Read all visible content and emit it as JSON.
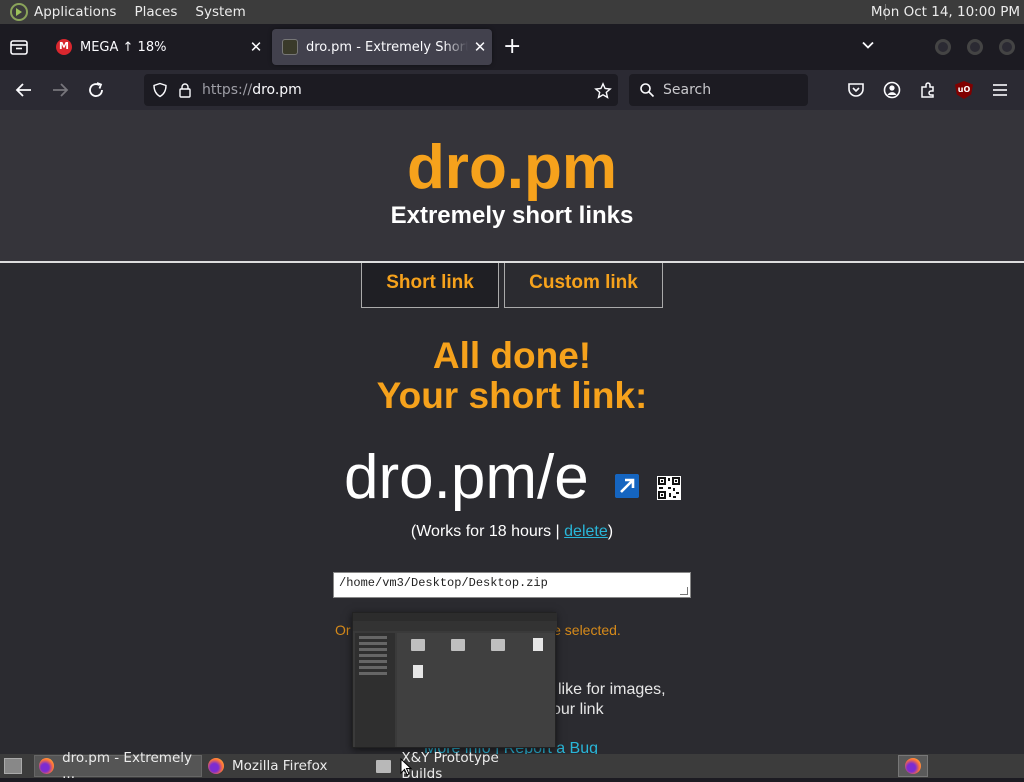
{
  "top_panel": {
    "menus": [
      "Applications",
      "Places",
      "System"
    ],
    "clock": "Mon Oct 14, 10:00 PM"
  },
  "browser": {
    "tabs": [
      {
        "title": "MEGA ↑ 18%",
        "favicon": "mega-icon",
        "active": false
      },
      {
        "title": "dro.pm - Extremely Short Li",
        "favicon": "dro-icon",
        "active": true
      }
    ],
    "url_scheme": "https://",
    "url_host": "dro.pm",
    "search_placeholder": "Search"
  },
  "page": {
    "site_name": "dro.pm",
    "tagline": "Extremely short links",
    "tabs": [
      "Short link",
      "Custom link"
    ],
    "done_line1": "All done!",
    "done_line2": "Your short link:",
    "short_link": "dro.pm/e",
    "works_prefix": "(Works for 18 hours | ",
    "delete_label": "delete",
    "works_suffix": ")",
    "path_value": "/home/vm3/Desktop/Desktop.zip",
    "orange_left": "Or",
    "orange_right": "le selected.",
    "info_line1": "like for images,",
    "info_line2": "our link",
    "bottom_links": "More info | Report a Bug",
    "accent_color": "#f6a21c",
    "link_color": "#29b6d8"
  },
  "taskbar": {
    "tasks": [
      {
        "label": "dro.pm - Extremely ...",
        "icon": "firefox-icon",
        "active": true
      },
      {
        "label": "Mozilla Firefox",
        "icon": "firefox-icon",
        "active": false
      },
      {
        "label": "X&Y Prototype Builds",
        "icon": "folder-icon",
        "active": false
      }
    ]
  }
}
